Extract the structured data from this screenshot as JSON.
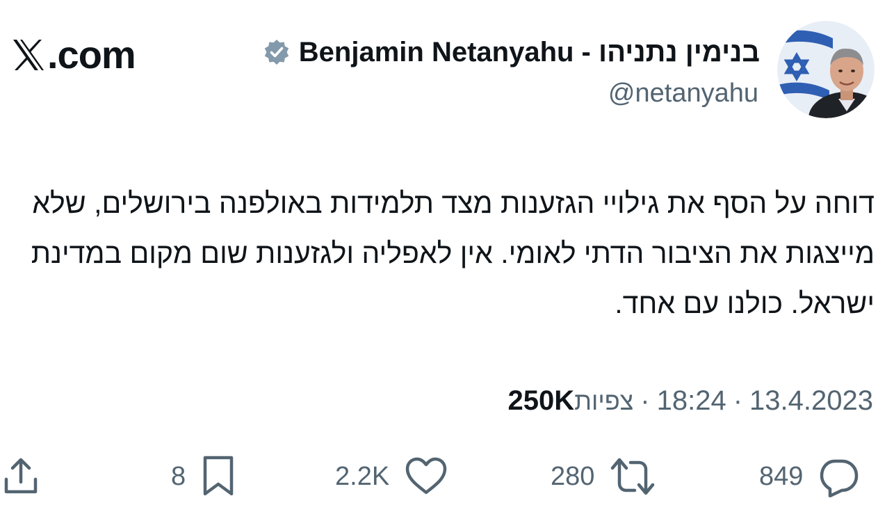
{
  "header": {
    "site_logo_text": ".com",
    "display_name": "Benjamin Netanyahu - בנימין נתניהו",
    "handle": "@netanyahu",
    "verified": true
  },
  "tweet": {
    "text": "דוחה על הסף את גילויי הגזענות מצד תלמידות באולפנה בירושלים, שלא מייצגות את הציבור הדתי לאומי. אין לאפליה ולגזענות שום מקום במדינת ישראל. כולנו עם אחד."
  },
  "meta": {
    "date": "13.4.2023",
    "time": "18:24",
    "separator": "·",
    "views_label": "צפיות",
    "views_count": "250K"
  },
  "actions": {
    "replies": "849",
    "reposts": "280",
    "likes": "2.2K",
    "bookmarks": "8"
  },
  "colors": {
    "text_primary": "#0f1419",
    "text_secondary": "#536471",
    "verified_badge": "#829aab"
  },
  "icons": [
    "x-logo-icon",
    "verified-badge-icon",
    "reply-icon",
    "repost-icon",
    "like-icon",
    "bookmark-icon",
    "share-icon"
  ]
}
